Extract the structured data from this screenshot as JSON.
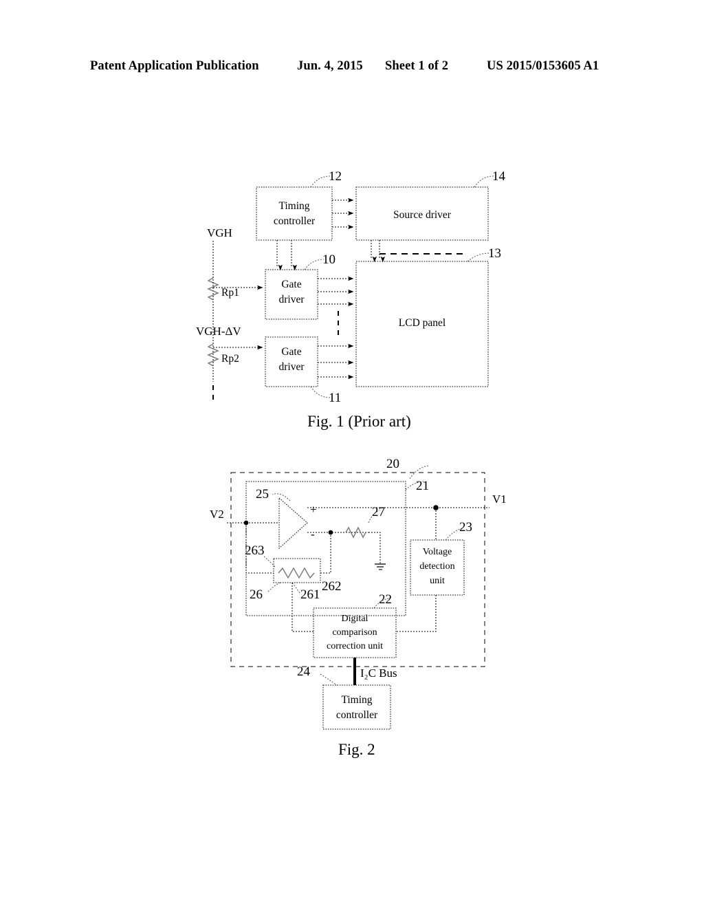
{
  "header": {
    "publication": "Patent Application Publication",
    "date": "Jun. 4, 2015",
    "sheet": "Sheet 1 of 2",
    "number": "US 2015/0153605 A1"
  },
  "figures": [
    {
      "id": "fig1",
      "caption": "Fig. 1 (Prior art)",
      "blocks": [
        {
          "ref": "12",
          "label_line1": "Timing",
          "label_line2": "controller"
        },
        {
          "ref": "14",
          "label_line1": "Source driver",
          "label_line2": ""
        },
        {
          "ref": "10",
          "label_line1": "Gate",
          "label_line2": "driver"
        },
        {
          "ref": "11",
          "label_line1": "Gate",
          "label_line2": "driver"
        },
        {
          "ref": "13",
          "label_line1": "LCD panel",
          "label_line2": ""
        }
      ],
      "signals": [
        {
          "name": "VGH"
        },
        {
          "name": "VGH-ΔV"
        }
      ],
      "resistors": [
        {
          "name": "Rp1"
        },
        {
          "name": "Rp2"
        }
      ],
      "refnums": [
        "10",
        "11",
        "12",
        "13",
        "14"
      ]
    },
    {
      "id": "fig2",
      "caption": "Fig. 2",
      "blocks": [
        {
          "ref": "23",
          "label_line1": "Voltage",
          "label_line2": "detection",
          "label_line3": "unit"
        },
        {
          "ref": "22",
          "label_line1": "Digital",
          "label_line2": "comparison",
          "label_line3": "correction unit"
        },
        {
          "ref": "24",
          "label_line1": "Timing",
          "label_line2": "controller",
          "label_line3": ""
        }
      ],
      "signals": [
        {
          "name": "V1"
        },
        {
          "name": "V2"
        }
      ],
      "bus_label": "I₂C Bus",
      "opamp": {
        "ref": "25",
        "plus": "+",
        "minus": "-"
      },
      "refnums": [
        "20",
        "21",
        "22",
        "23",
        "24",
        "25",
        "26",
        "261",
        "262",
        "263",
        "27"
      ]
    }
  ],
  "colors": {
    "ink": "#000000",
    "paper": "#ffffff",
    "faint": "#8a8a8a"
  }
}
